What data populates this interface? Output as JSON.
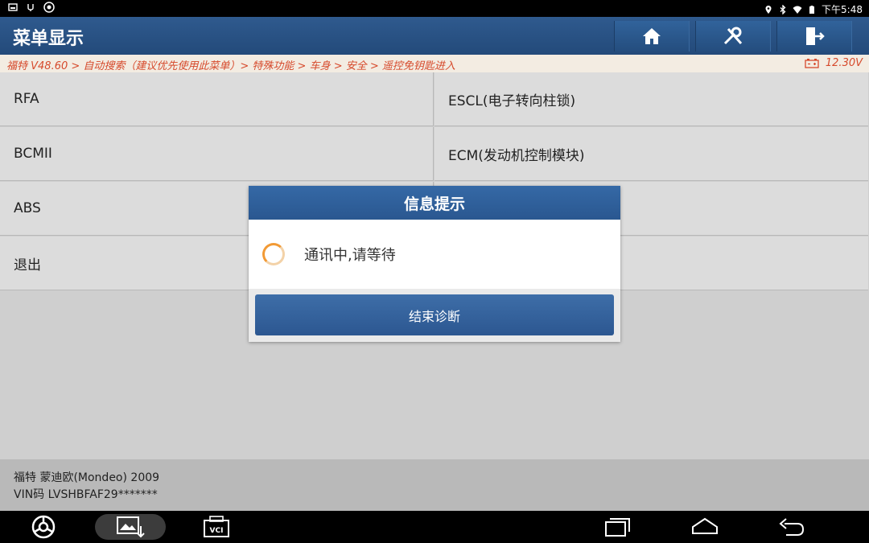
{
  "status_bar": {
    "time": "下午5:48",
    "left_icons": [
      "image-icon",
      "usb-icon",
      "settings-circle-icon"
    ],
    "right_icons": [
      "location-icon",
      "bluetooth-icon",
      "wifi-icon",
      "battery-icon"
    ]
  },
  "header": {
    "title": "菜单显示",
    "buttons": [
      "home-icon",
      "diagnose-tools-icon",
      "exit-icon"
    ]
  },
  "breadcrumb": {
    "path": "福特 V48.60 > 自动搜索（建议优先使用此菜单）> 特殊功能 > 车身 > 安全 > 遥控免钥匙进入",
    "voltage": "12.30V"
  },
  "menu": {
    "items": [
      {
        "label": "RFA"
      },
      {
        "label": "ESCL(电子转向柱锁)"
      },
      {
        "label": "BCMII"
      },
      {
        "label": "ECM(发动机控制模块)"
      },
      {
        "label": "ABS"
      },
      {
        "label": ""
      },
      {
        "label": "退出"
      },
      {
        "label": ""
      }
    ]
  },
  "footer": {
    "vehicle": "福特 蒙迪欧(Mondeo) 2009",
    "vin": "VIN码 LVSHBFAF29*******"
  },
  "dialog": {
    "title": "信息提示",
    "message": "通讯中,请等待",
    "button": "结束诊断"
  },
  "nav": {
    "items": [
      "browser-icon",
      "screenshot-icon",
      "vci-icon",
      "recent-apps-icon",
      "home-nav-icon",
      "back-icon"
    ],
    "vci_label": "VCI"
  },
  "colors": {
    "header": "#2a5287",
    "crumb_text": "#d64a2c",
    "accent_spinner": "#f29a35"
  }
}
